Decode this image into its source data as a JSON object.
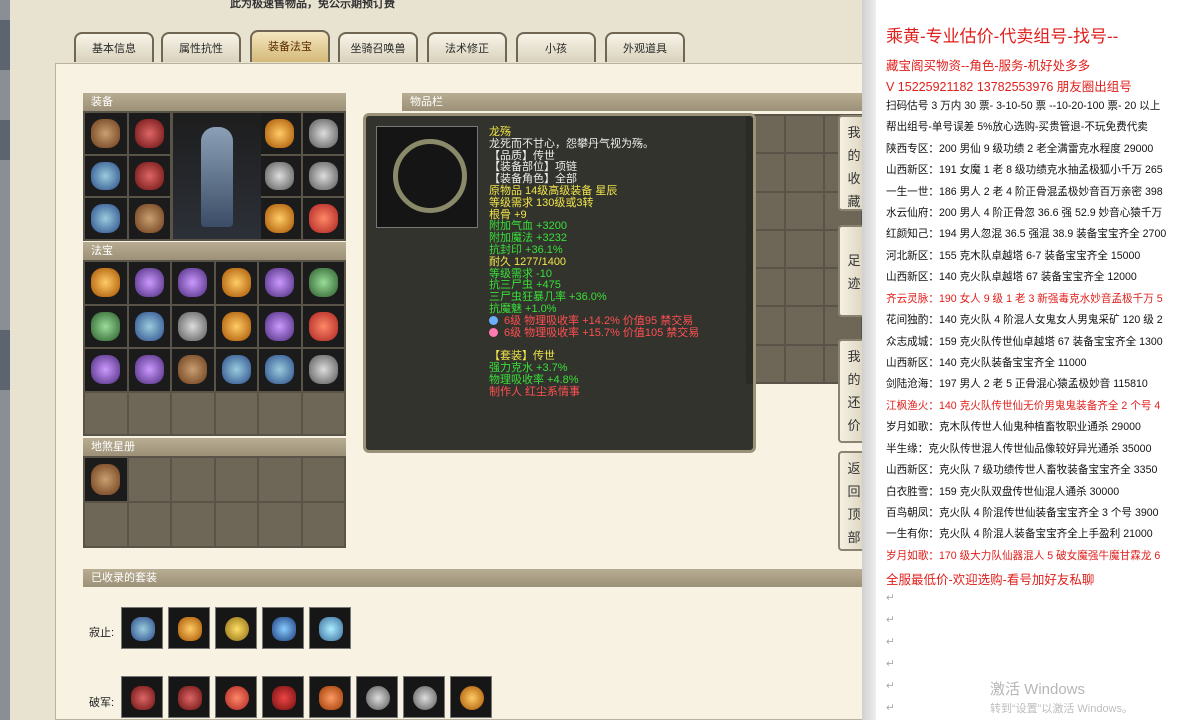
{
  "top_note": "此为极速售物品，免公示期预订费",
  "tabs": [
    "基本信息",
    "属性抗性",
    "装备法宝",
    "坐骑召唤兽",
    "法术修正",
    "小孩",
    "外观道具"
  ],
  "panels": {
    "equipment_title": "装备",
    "fabao_title": "法宝",
    "zhenfa_title": "地煞星册",
    "items_title": "物品栏",
    "suits_title": "已收录的套装"
  },
  "tooltip": {
    "name": "龙殇",
    "desc": "龙死而不甘心，怨攀丹气视为殇。",
    "quality": "【品质】传世",
    "slot": "【装备部位】项链",
    "role": "【装备角色】全部",
    "origin": "原物品 14级高级装备 星辰",
    "level_req": "等级需求 130级或3转",
    "root": "根骨 +9",
    "add_hp": "附加气血 +3200",
    "add_mp": "附加魔法 +3232",
    "anti_seal": "抗封印 +36.1%",
    "durability": "耐久 1277/1400",
    "level_req2": "等级需求 -10",
    "anti_sanshi": "抗三尸虫 +475",
    "sanshi_frenzy": "三尸虫狂暴几率 +36.0%",
    "anti_meihuo": "抗魔魅 +1.0%",
    "gem1": "6级 物理吸收率 +14.2% 价值95 禁交易",
    "gem2": "6级 物理吸收率 +15.7% 价值105 禁交易",
    "suit_label": "【套装】传世",
    "suit_attr1": "强力克水 +3.7%",
    "suit_attr2": "物理吸收率 +4.8%",
    "maker": "制作人 红尘系情事"
  },
  "side_buttons": [
    "我的收藏",
    "足迹",
    "我的还价",
    "返回顶部"
  ],
  "suits": {
    "row1_label": "寂止:",
    "row2_label": "破军:"
  },
  "notepad": {
    "lines": [
      "乘黄-专业估价-代卖组号-找号--",
      "藏宝阁买物资--角色-服务-机好处多多",
      "V 15225921182   13782553976 朋友圈出组号",
      "扫码估号 3 万内 30 票- 3-10-50 票  --10-20-100 票- 20 以上",
      "帮出组号-单号误差 5%放心选购-买贵管退-不玩免费代卖",
      "陕西专区：200 男仙 9 级功绩 2 老全满雷克水程度 29000",
      "山西新区：191 女魔 1 老 8 级功绩克水抽孟极狐小千万 265",
      "一生一世：186 男人 2 老 4 阶正骨混孟极妙音百万亲密 398",
      "水云仙府：200 男人 4 阶正骨忽 36.6 强 52.9 妙音心猿千万",
      "红颜知己：194 男人忽混 36.5 强混 38.9 装备宝宝齐全 2700",
      "河北新区：155 克木队卓越塔 6-7 装备宝宝齐全 15000",
      "山西新区：140 克火队卓越塔 67 装备宝宝齐全 12000",
      "齐云灵脉：190 女人 9 级 1 老 3 新强毒克水妙音孟极千万 5",
      "花间独酌：140 克火队 4 阶混人女鬼女人男鬼采矿 120 级 2",
      "众志成城：159 克火队传世仙卓越塔 67 装备宝宝齐全 1300",
      "山西新区：140 克火队装备宝宝齐全 11000",
      "剑陆沧海：197 男人 2 老 5 正骨混心猿孟极妙音 115810",
      "江枫渔火：140 克火队传世仙无价男鬼鬼装备齐全 2 个号 4",
      "岁月如歌：克木队传世人仙鬼种植畜牧职业通杀 29000",
      "半生缘：克火队传世混人传世仙品像较好异光通杀 35000",
      "山西新区：克火队 7 级功绩传世人畜牧装备宝宝齐全 3350",
      "白衣胜雪：159 克火队双盘传世仙混人通杀 30000",
      "百鸟朝凤：克火队 4 阶混传世仙装备宝宝齐全 3 个号 3900",
      "一生有你：克火队 4 阶混人装备宝宝齐全上手盈利 21000",
      "岁月如歌：170 级大力队仙器混人 5 破女魔强牛魔甘霖龙 6",
      "全服最低价-欢迎选购-看号加好友私聊"
    ],
    "watermark_title": "激活 Windows",
    "watermark_sub": "转到“设置”以激活 Windows。"
  }
}
